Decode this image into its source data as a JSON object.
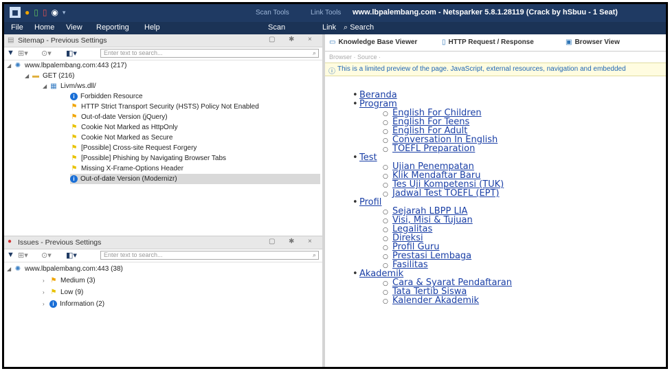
{
  "titlebar": {
    "tool_tabs": [
      "Scan Tools",
      "Link Tools"
    ],
    "app_title": "www.lbpalembang.com - Netsparker 5.8.1.28119 (Crack by hSbuu - 1 Seat)"
  },
  "menu": [
    "File",
    "Home",
    "View",
    "Reporting",
    "Help",
    "Scan",
    "Link",
    "Search"
  ],
  "sitemap": {
    "title": "Sitemap - Previous Settings",
    "search_placeholder": "Enter text to search...",
    "root": "www.lbpalembang.com:443 (217)",
    "get": "GET (216)",
    "path": "Livm/ws.dll/",
    "issues": [
      {
        "label": "Forbidden Resource",
        "icon": "info"
      },
      {
        "label": "HTTP Strict Transport Security (HSTS) Policy Not Enabled",
        "icon": "flag-orange"
      },
      {
        "label": "Out-of-date Version (jQuery)",
        "icon": "flag-orange"
      },
      {
        "label": "Cookie Not Marked as HttpOnly",
        "icon": "flag-yellow"
      },
      {
        "label": "Cookie Not Marked as Secure",
        "icon": "flag-yellow"
      },
      {
        "label": "[Possible] Cross-site Request Forgery",
        "icon": "flag-yellow"
      },
      {
        "label": "[Possible] Phishing by Navigating Browser Tabs",
        "icon": "flag-yellow"
      },
      {
        "label": "Missing X-Frame-Options Header",
        "icon": "flag-yellow"
      },
      {
        "label": "Out-of-date Version (Modernizr)",
        "icon": "info"
      }
    ]
  },
  "issues_pane": {
    "title": "Issues - Previous Settings",
    "search_placeholder": "Enter text to search...",
    "root": "www.lbpalembang.com:443 (38)",
    "groups": [
      "Medium (3)",
      "Low (9)",
      "Information (2)"
    ]
  },
  "right_tabs": [
    "Knowledge Base Viewer",
    "HTTP Request / Response",
    "Browser View"
  ],
  "subbar": "Browser · Source ·",
  "notice": "This is a limited preview of the page. JavaScript, external resources, navigation and embedded",
  "nav": {
    "beranda": "Beranda",
    "program": "Program",
    "program_items": [
      "English For Children",
      "English For Teens",
      "English For Adult",
      "Conversation In English",
      "TOEFL Preparation"
    ],
    "test": "Test",
    "test_items": [
      "Ujian Penempatan",
      "Klik Mendaftar Baru",
      "Tes Uji Kompetensi (TUK)",
      "Jadwal Test TOEFL (EPT)"
    ],
    "profil": "Profil",
    "profil_items": [
      "Sejarah LBPP LIA",
      "Visi, Misi & Tujuan",
      "Legalitas",
      "Direksi",
      "Profil Guru",
      "Prestasi Lembaga",
      "Fasilitas"
    ],
    "akademik": "Akademik",
    "akademik_items": [
      "Cara & Syarat Pendaftaran",
      "Tata Tertib Siswa",
      "Kalender Akademik"
    ]
  }
}
